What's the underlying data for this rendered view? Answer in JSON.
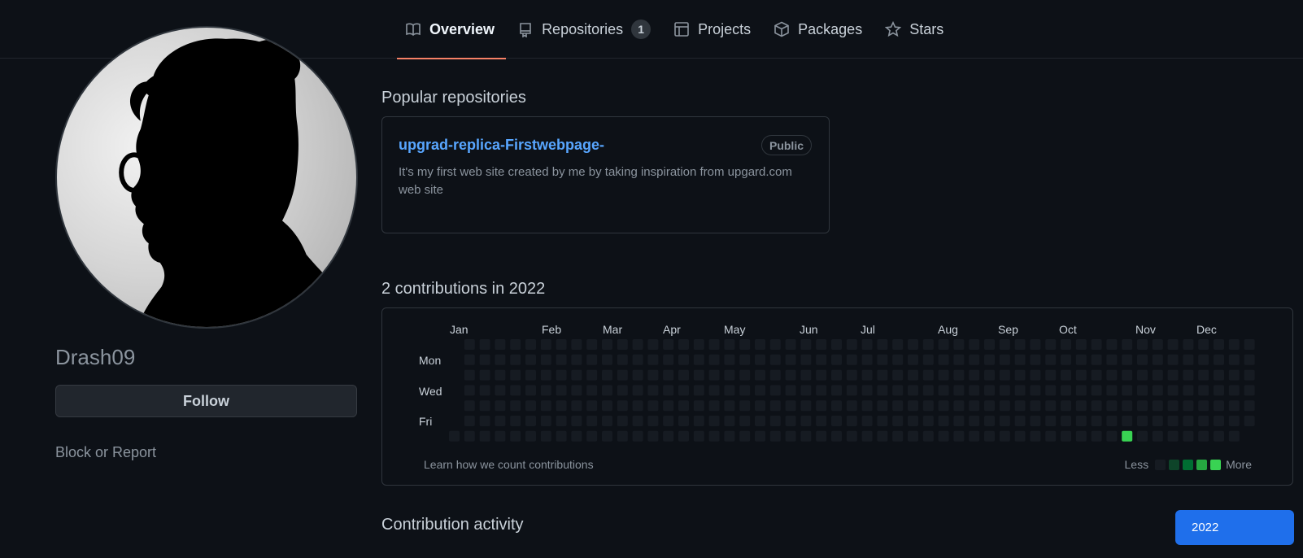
{
  "nav": {
    "tabs": [
      {
        "label": "Overview",
        "icon": "book-icon",
        "active": true
      },
      {
        "label": "Repositories",
        "icon": "repo-icon",
        "count": "1"
      },
      {
        "label": "Projects",
        "icon": "project-icon"
      },
      {
        "label": "Packages",
        "icon": "package-icon"
      },
      {
        "label": "Stars",
        "icon": "star-icon"
      }
    ]
  },
  "profile": {
    "username": "Drash09",
    "follow_label": "Follow",
    "block_label": "Block or Report"
  },
  "popular": {
    "title": "Popular repositories",
    "repos": [
      {
        "name": "upgrad-replica-Firstwebpage-",
        "visibility": "Public",
        "description": "It's my first web site created by me by taking inspiration from upgard.com web site"
      }
    ]
  },
  "contributions": {
    "title": "2 contributions in 2022",
    "months": [
      "Jan",
      "Feb",
      "Mar",
      "Apr",
      "May",
      "Jun",
      "Jul",
      "Aug",
      "Sep",
      "Oct",
      "Nov",
      "Dec"
    ],
    "day_labels": [
      "Mon",
      "Wed",
      "Fri"
    ],
    "learn_label": "Learn how we count contributions",
    "legend_less": "Less",
    "legend_more": "More",
    "legend_colors": [
      "#161b22",
      "#0e4429",
      "#006d32",
      "#26a641",
      "#39d353"
    ],
    "empty_color": "#161b22",
    "active_cells": [
      {
        "week": 44,
        "day": 6,
        "level": 4
      }
    ]
  },
  "activity": {
    "title": "Contribution activity",
    "year_label": "2022"
  },
  "colors": {
    "background": "#0d1117",
    "accent_tab": "#f78166",
    "link": "#58a6ff",
    "primary_button": "#1f6feb"
  }
}
